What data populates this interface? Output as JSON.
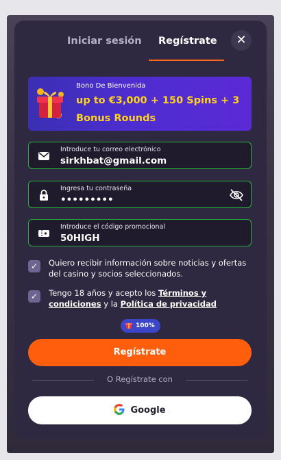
{
  "tabs": [
    {
      "label": "Iniciar sesión",
      "active": false
    },
    {
      "label": "Regístrate",
      "active": true
    }
  ],
  "close_glyph": "✕",
  "banner": {
    "subtitle": "Bono De Bienvenida",
    "title": "up to €3,000 + 150 Spins + 3 Bonus Rounds"
  },
  "email": {
    "label": "Introduce tu correo electrónico",
    "value": "sirkhbat@gmail.com",
    "icon": "envelope-icon"
  },
  "password": {
    "label": "Ingresa tu contraseña",
    "value": "•••••••••",
    "icon": "lock-icon",
    "toggle_icon": "eye-off-icon"
  },
  "promo": {
    "label": "Introduce el código promocional",
    "value": "50HIGH",
    "icon": "ticket-icon"
  },
  "consent_marketing": {
    "checked": true,
    "text": "Quiero recibir información sobre noticias y ofertas del casino y socios seleccionados."
  },
  "consent_terms": {
    "checked": true,
    "prefix": "Tengo 18 años y acepto los ",
    "terms_link": "Términos y condiciones",
    "middle": " y la ",
    "privacy_link": "Política de privacidad"
  },
  "progress_badge": {
    "value": "100%",
    "icon": "gift-icon"
  },
  "primary_button": {
    "label": "Regístrate"
  },
  "divider_text": "O Regístrate con",
  "google_button": {
    "label": "Google",
    "icon": "google-icon"
  },
  "colors": {
    "accent": "#ff5f0d",
    "field_border": "#27b43a",
    "banner_text": "#ffd21a",
    "modal_bg": "#2e2840"
  }
}
